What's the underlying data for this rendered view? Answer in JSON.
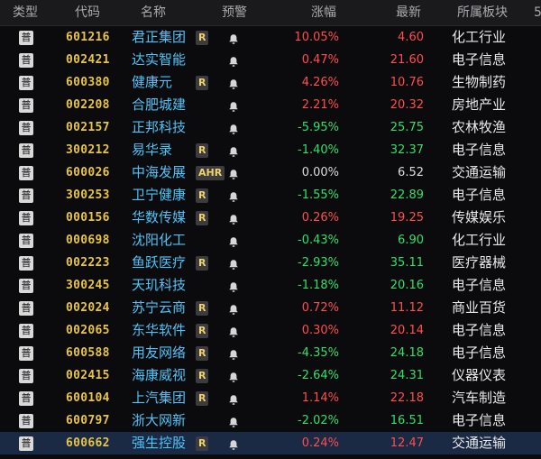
{
  "header": {
    "type": "类型",
    "code": "代码",
    "name": "名称",
    "alert": "预警",
    "change": "涨幅",
    "last": "最新",
    "sector": "所属板块",
    "extra": "5"
  },
  "type_badge": "普",
  "colors": {
    "up": "#ff4d4d",
    "down": "#2ee06b",
    "flat": "#dcdcdc",
    "code": "#e6c34a",
    "name": "#4fc3f7"
  },
  "rows": [
    {
      "code": "601216",
      "name": "君正集团",
      "badge": "R",
      "change": "10.05%",
      "last": "4.60",
      "dir": "up",
      "sector": "化工行业"
    },
    {
      "code": "002421",
      "name": "达实智能",
      "badge": "",
      "change": "0.47%",
      "last": "21.60",
      "dir": "up",
      "sector": "电子信息"
    },
    {
      "code": "600380",
      "name": "健康元",
      "badge": "R",
      "change": "4.26%",
      "last": "10.76",
      "dir": "up",
      "sector": "生物制药"
    },
    {
      "code": "002208",
      "name": "合肥城建",
      "badge": "",
      "change": "2.21%",
      "last": "20.32",
      "dir": "up",
      "sector": "房地产业"
    },
    {
      "code": "002157",
      "name": "正邦科技",
      "badge": "",
      "change": "-5.95%",
      "last": "25.75",
      "dir": "down",
      "sector": "农林牧渔"
    },
    {
      "code": "300212",
      "name": "易华录",
      "badge": "R",
      "change": "-1.40%",
      "last": "32.37",
      "dir": "down",
      "sector": "电子信息"
    },
    {
      "code": "600026",
      "name": "中海发展",
      "badge": "AHR",
      "change": "0.00%",
      "last": "6.52",
      "dir": "flat",
      "sector": "交通运输"
    },
    {
      "code": "300253",
      "name": "卫宁健康",
      "badge": "R",
      "change": "-1.55%",
      "last": "22.89",
      "dir": "down",
      "sector": "电子信息"
    },
    {
      "code": "000156",
      "name": "华数传媒",
      "badge": "R",
      "change": "0.26%",
      "last": "19.25",
      "dir": "up",
      "sector": "传媒娱乐"
    },
    {
      "code": "000698",
      "name": "沈阳化工",
      "badge": "",
      "change": "-0.43%",
      "last": "6.90",
      "dir": "down",
      "sector": "化工行业"
    },
    {
      "code": "002223",
      "name": "鱼跃医疗",
      "badge": "R",
      "change": "-2.93%",
      "last": "35.11",
      "dir": "down",
      "sector": "医疗器械"
    },
    {
      "code": "300245",
      "name": "天玑科技",
      "badge": "",
      "change": "-1.18%",
      "last": "20.16",
      "dir": "down",
      "sector": "电子信息"
    },
    {
      "code": "002024",
      "name": "苏宁云商",
      "badge": "R",
      "change": "0.72%",
      "last": "11.12",
      "dir": "up",
      "sector": "商业百货"
    },
    {
      "code": "002065",
      "name": "东华软件",
      "badge": "R",
      "change": "0.30%",
      "last": "20.14",
      "dir": "up",
      "sector": "电子信息"
    },
    {
      "code": "600588",
      "name": "用友网络",
      "badge": "R",
      "change": "-4.35%",
      "last": "24.18",
      "dir": "down",
      "sector": "电子信息"
    },
    {
      "code": "002415",
      "name": "海康威视",
      "badge": "R",
      "change": "-2.64%",
      "last": "24.31",
      "dir": "down",
      "sector": "仪器仪表"
    },
    {
      "code": "600104",
      "name": "上汽集团",
      "badge": "R",
      "change": "1.14%",
      "last": "22.18",
      "dir": "up",
      "sector": "汽车制造"
    },
    {
      "code": "600797",
      "name": "浙大网新",
      "badge": "",
      "change": "-2.02%",
      "last": "16.51",
      "dir": "down",
      "sector": "电子信息"
    },
    {
      "code": "600662",
      "name": "强生控股",
      "badge": "R",
      "change": "0.24%",
      "last": "12.47",
      "dir": "up",
      "sector": "交通运输",
      "selected": true
    }
  ]
}
